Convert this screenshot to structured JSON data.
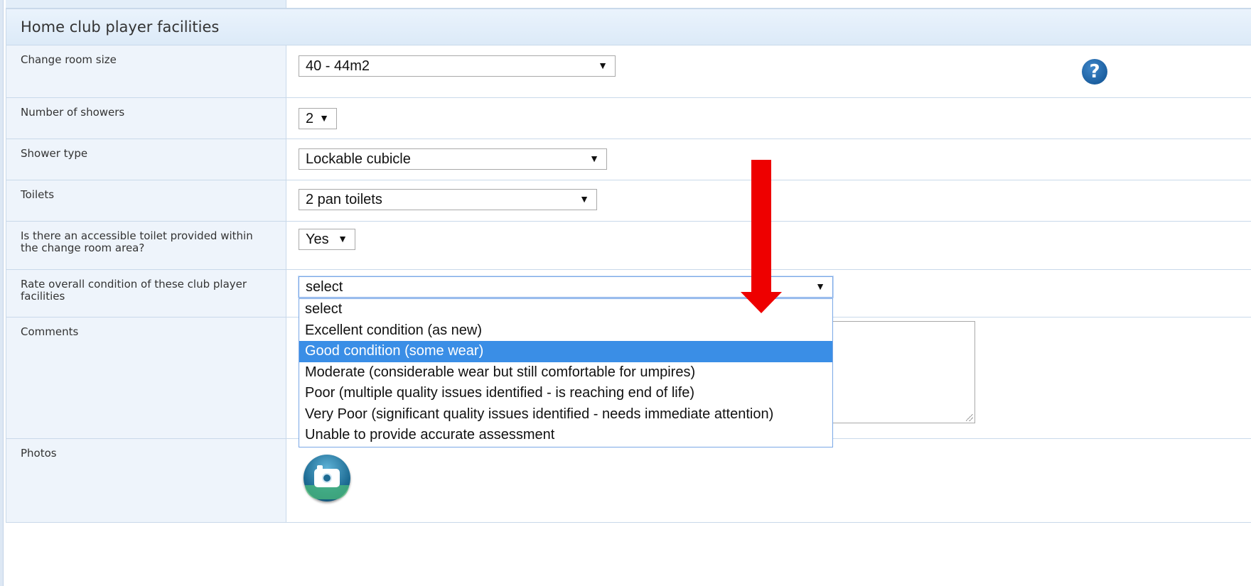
{
  "section": {
    "title": "Home club player facilities"
  },
  "fields": {
    "change_room_size": {
      "label": "Change room size",
      "value": "40 - 44m2"
    },
    "showers": {
      "label": "Number of showers",
      "value": "2"
    },
    "shower_type": {
      "label": "Shower type",
      "value": "Lockable cubicle"
    },
    "toilets": {
      "label": "Toilets",
      "value": "2 pan toilets"
    },
    "accessible_toilet": {
      "label": "Is there an accessible toilet provided within the change room area?",
      "value": "Yes"
    },
    "rate_condition": {
      "label": "Rate overall condition of these club player facilities",
      "value": "select",
      "options": [
        "select",
        "Excellent condition (as new)",
        "Good condition (some wear)",
        "Moderate (considerable wear but still comfortable for umpires)",
        "Poor (multiple quality issues identified - is reaching end of life)",
        "Very Poor (significant quality issues identified - needs immediate attention)",
        "Unable to provide accurate assessment"
      ],
      "highlighted_option": "Good condition (some wear)"
    },
    "comments": {
      "label": "Comments",
      "value": ""
    },
    "photos": {
      "label": "Photos"
    }
  },
  "icons": {
    "help": "help-icon",
    "camera": "camera-icon",
    "arrow": "red-down-arrow"
  },
  "colors": {
    "highlight": "#3a8ee6",
    "annotation_arrow": "#ee0000",
    "header_bg": "#dceaf8"
  }
}
